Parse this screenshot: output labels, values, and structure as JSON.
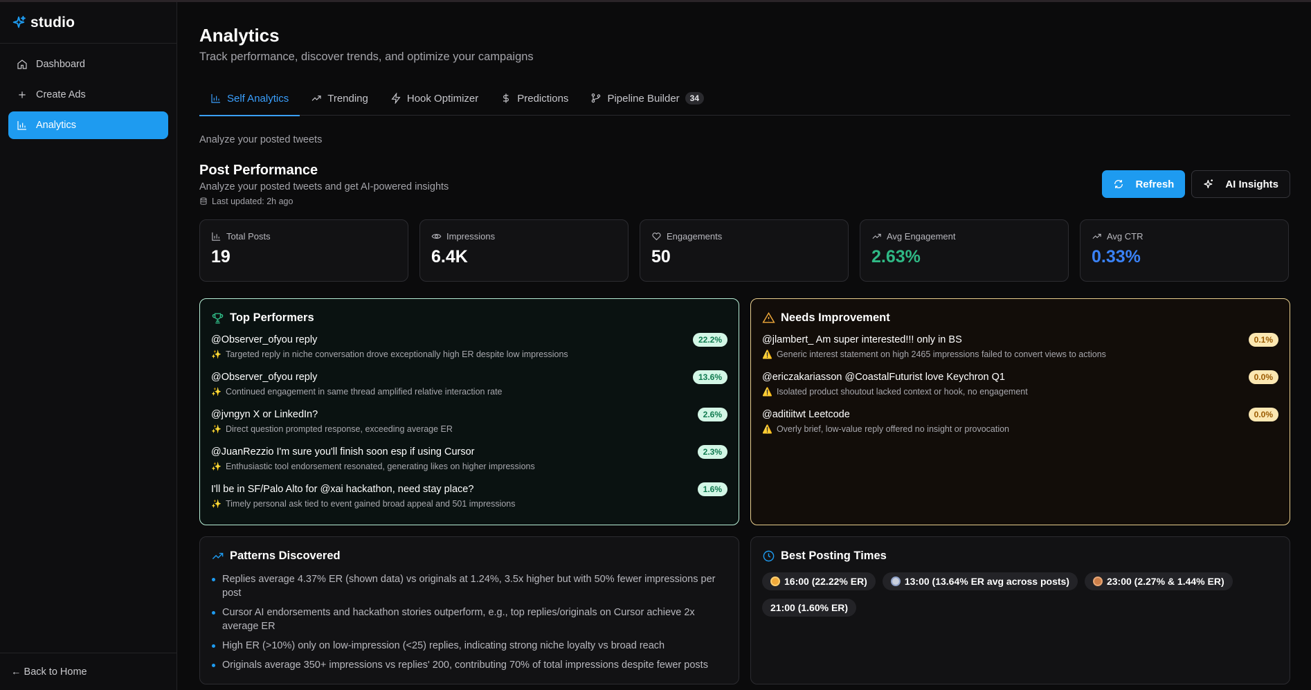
{
  "app": {
    "name": "studio"
  },
  "sidebar": {
    "items": [
      {
        "label": "Dashboard",
        "icon": "home-icon"
      },
      {
        "label": "Create Ads",
        "icon": "plus-icon"
      },
      {
        "label": "Analytics",
        "icon": "bar-chart-icon",
        "active": true
      }
    ],
    "back_label": "← Back to Home"
  },
  "header": {
    "title": "Analytics",
    "subtitle": "Track performance, discover trends, and optimize your campaigns"
  },
  "tabs": [
    {
      "label": "Self Analytics",
      "icon": "bar-chart-icon",
      "active": true
    },
    {
      "label": "Trending",
      "icon": "trending-up-icon"
    },
    {
      "label": "Hook Optimizer",
      "icon": "zap-icon"
    },
    {
      "label": "Predictions",
      "icon": "dollar-icon"
    },
    {
      "label": "Pipeline Builder",
      "icon": "git-branch-icon",
      "badge": "34"
    }
  ],
  "section_note": "Analyze your posted tweets",
  "performance": {
    "title": "Post Performance",
    "subtitle": "Analyze your posted tweets and get AI-powered insights",
    "last_updated": "Last updated: 2h ago",
    "refresh_label": "Refresh",
    "ai_insights_label": "AI Insights"
  },
  "stats": [
    {
      "label": "Total Posts",
      "value": "19",
      "icon": "bar-chart-icon"
    },
    {
      "label": "Impressions",
      "value": "6.4K",
      "icon": "eye-icon"
    },
    {
      "label": "Engagements",
      "value": "50",
      "icon": "heart-icon"
    },
    {
      "label": "Avg Engagement",
      "value": "2.63%",
      "icon": "trending-up-icon",
      "color": "#2fb985"
    },
    {
      "label": "Avg CTR",
      "value": "0.33%",
      "icon": "trending-up-icon",
      "color": "#3a82f7"
    }
  ],
  "top_performers": {
    "title": "Top Performers",
    "items": [
      {
        "title": "@Observer_ofyou reply",
        "rate": "22.2%",
        "note": "Targeted reply in niche conversation drove exceptionally high ER despite low impressions"
      },
      {
        "title": "@Observer_ofyou reply",
        "rate": "13.6%",
        "note": "Continued engagement in same thread amplified relative interaction rate"
      },
      {
        "title": "@jvngyn X or LinkedIn?",
        "rate": "2.6%",
        "note": "Direct question prompted response, exceeding average ER"
      },
      {
        "title": "@JuanRezzio I'm sure you'll finish soon esp if using Cursor",
        "rate": "2.3%",
        "note": "Enthusiastic tool endorsement resonated, generating likes on higher impressions"
      },
      {
        "title": "I'll be in SF/Palo Alto for @xai hackathon, need stay place?",
        "rate": "1.6%",
        "note": "Timely personal ask tied to event gained broad appeal and 501 impressions"
      }
    ]
  },
  "needs_improvement": {
    "title": "Needs Improvement",
    "items": [
      {
        "title": "@jlambert_ Am super interested!!! only in BS",
        "rate": "0.1%",
        "note": "Generic interest statement on high 2465 impressions failed to convert views to actions"
      },
      {
        "title": "@ericzakariasson @CoastalFuturist love Keychron Q1",
        "rate": "0.0%",
        "note": "Isolated product shoutout lacked context or hook, no engagement"
      },
      {
        "title": "@aditiitwt Leetcode",
        "rate": "0.0%",
        "note": "Overly brief, low-value reply offered no insight or provocation"
      }
    ]
  },
  "patterns": {
    "title": "Patterns Discovered",
    "items": [
      "Replies average 4.37% ER (shown data) vs originals at 1.24%, 3.5x higher but with 50% fewer impressions per post",
      "Cursor AI endorsements and hackathon stories outperform, e.g., top replies/originals on Cursor achieve 2x average ER",
      "High ER (>10%) only on low-impression (<25) replies, indicating strong niche loyalty vs broad reach",
      "Originals average 350+ impressions vs replies' 200, contributing 70% of total impressions despite fewer posts"
    ]
  },
  "posting_times": {
    "title": "Best Posting Times",
    "items": [
      {
        "label": "16:00 (22.22% ER)",
        "medal": "gold"
      },
      {
        "label": "13:00 (13.64% ER avg across posts)",
        "medal": "silver"
      },
      {
        "label": "23:00 (2.27% & 1.44% ER)",
        "medal": "bronze"
      },
      {
        "label": "21:00 (1.60% ER)",
        "medal": ""
      }
    ]
  },
  "colors": {
    "accent": "#1e9bf0",
    "success": "#2fb985",
    "warning": "#f0a93a"
  }
}
